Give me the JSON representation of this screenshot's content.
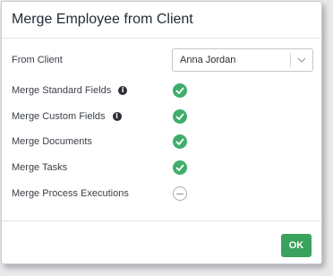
{
  "dialog": {
    "title": "Merge Employee from Client"
  },
  "from_client": {
    "label": "From Client",
    "selected": "Anna Jordan"
  },
  "options": [
    {
      "label": "Merge Standard Fields",
      "info": true,
      "state": "checked"
    },
    {
      "label": "Merge Custom Fields",
      "info": true,
      "state": "checked"
    },
    {
      "label": "Merge Documents",
      "info": false,
      "state": "checked"
    },
    {
      "label": "Merge Tasks",
      "info": false,
      "state": "checked"
    },
    {
      "label": "Merge Process Executions",
      "info": false,
      "state": "unchecked"
    }
  ],
  "footer": {
    "ok_label": "OK"
  },
  "colors": {
    "accent_green": "#3fae6c",
    "ok_button": "#3aa25c"
  },
  "icons": {
    "info": "info-icon",
    "checked": "check-circle-icon",
    "unchecked": "minus-circle-icon",
    "dropdown": "chevron-down-icon"
  }
}
